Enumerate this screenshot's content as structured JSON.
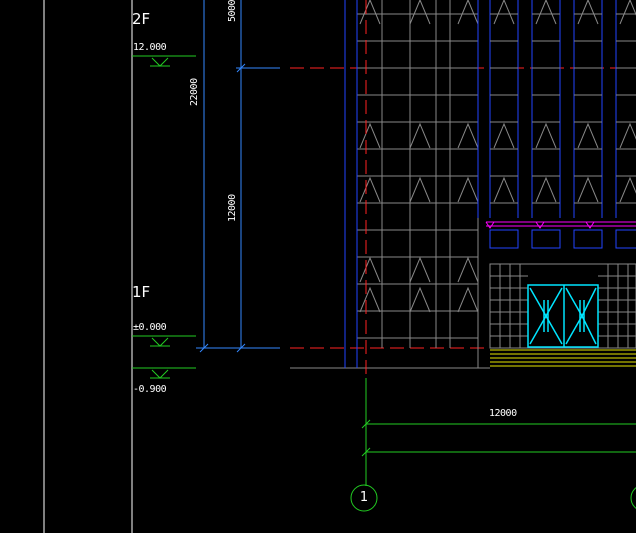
{
  "levels": [
    {
      "floor": "2F",
      "elevation": "12.000"
    },
    {
      "floor": "1F",
      "elevation": "±0.000"
    },
    {
      "floor": "",
      "elevation": "-0.900"
    }
  ],
  "dimensions": {
    "overall_height": "22000",
    "upper_segment": "5000",
    "lower_segment": "12000",
    "axis_span": "12000"
  },
  "grid_axis": {
    "label": "1"
  },
  "colors": {
    "background": "#000000",
    "level_lines": "#22cc22",
    "dimension_lines": "#3388ff",
    "facade_grid": "#888888",
    "column_lines": "#2244ff",
    "axis_line": "#ff2222",
    "canopy": "#ff00ff",
    "door": "#00e5ff",
    "steps": "#e6e600",
    "text": "#ffffff"
  }
}
